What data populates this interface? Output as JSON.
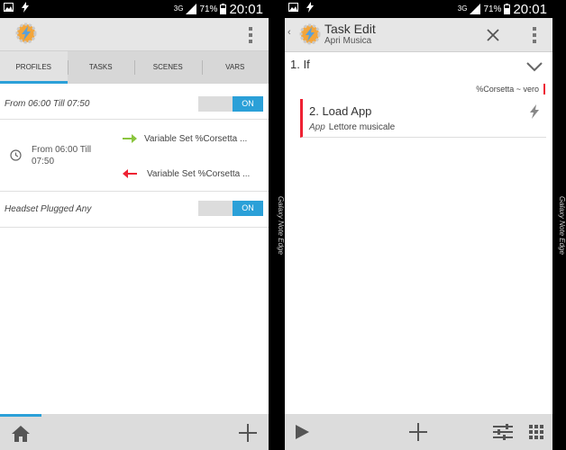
{
  "status_bar": {
    "network": "3G",
    "battery": "71%",
    "time": "20:01"
  },
  "left_screen": {
    "tabs": [
      {
        "label": "PROFILES",
        "active": true
      },
      {
        "label": "TASKS",
        "active": false
      },
      {
        "label": "SCENES",
        "active": false
      },
      {
        "label": "VARS",
        "active": false
      }
    ],
    "profiles": [
      {
        "title": "From 06:00 Till 07:50",
        "toggle": "ON"
      },
      {
        "title": "Headset Plugged Any",
        "toggle": "ON"
      }
    ],
    "context_text": "From 06:00 Till 07:50",
    "enter_task": "Variable Set %Corsetta ...",
    "exit_task": "Variable Set %Corsetta ..."
  },
  "right_screen": {
    "title": "Task Edit",
    "subtitle": "Apri Musica",
    "if_label": "1.  If",
    "condition": "%Corsetta ~ vero",
    "action": {
      "title": "2.  Load App",
      "arg_label": "App",
      "arg_value": "Lettore musicale"
    }
  },
  "edge_label": "Galaxy Note Edge",
  "icons": {
    "gallery": "gallery-icon",
    "flash": "flash-icon",
    "signal": "signal-icon",
    "battery": "battery-icon",
    "home": "home-icon",
    "add": "plus-icon",
    "play": "play-icon",
    "filter": "filter-icon",
    "grid": "grid-icon",
    "close": "close-icon"
  },
  "colors": {
    "accent": "#2ba0d8",
    "enter": "#8ac53e",
    "exit": "#e23",
    "bar": "#e6e6e6"
  }
}
